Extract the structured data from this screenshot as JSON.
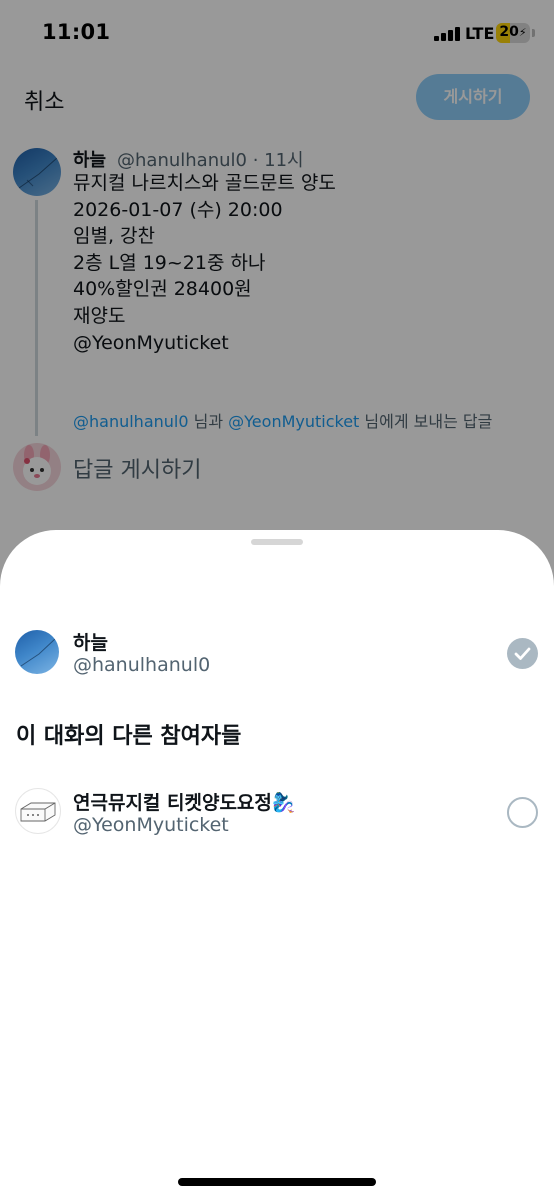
{
  "status_bar": {
    "time": "11:01",
    "network": "LTE",
    "battery": "20"
  },
  "compose": {
    "cancel_label": "취소",
    "post_label": "게시하기",
    "reply_placeholder": "답글 게시하기"
  },
  "tweet": {
    "author_name": "하늘",
    "author_handle": "@hanulhanul0",
    "time_ago": "11시",
    "lines": [
      "뮤지컬 나르치스와 골드문트 양도",
      "2026-01-07 (수) 20:00",
      "임별, 강찬",
      "2층 L열 19~21중 하나",
      "40%할인권 28400원",
      "재양도",
      "@YeonMyuticket"
    ]
  },
  "reply_to": {
    "handle_1": "@hanulhanul0",
    "joiner": " 님과 ",
    "handle_2": "@YeonMyuticket",
    "suffix": " 님에게 보내는 답글"
  },
  "sheet": {
    "primary_user": {
      "name": "하늘",
      "handle": "@hanulhanul0",
      "selected": true
    },
    "section_title": "이 대화의 다른 참여자들",
    "others": [
      {
        "name": "연극뮤지컬 티켓양도요정🧞‍♀️",
        "handle": "@YeonMyuticket",
        "selected": false
      }
    ]
  },
  "colors": {
    "accent": "#1d9bf0",
    "post_button_disabled": "#8ecdf8",
    "secondary_text": "#536471",
    "primary_text": "#0f1419",
    "check_gray": "#aab8c2"
  }
}
